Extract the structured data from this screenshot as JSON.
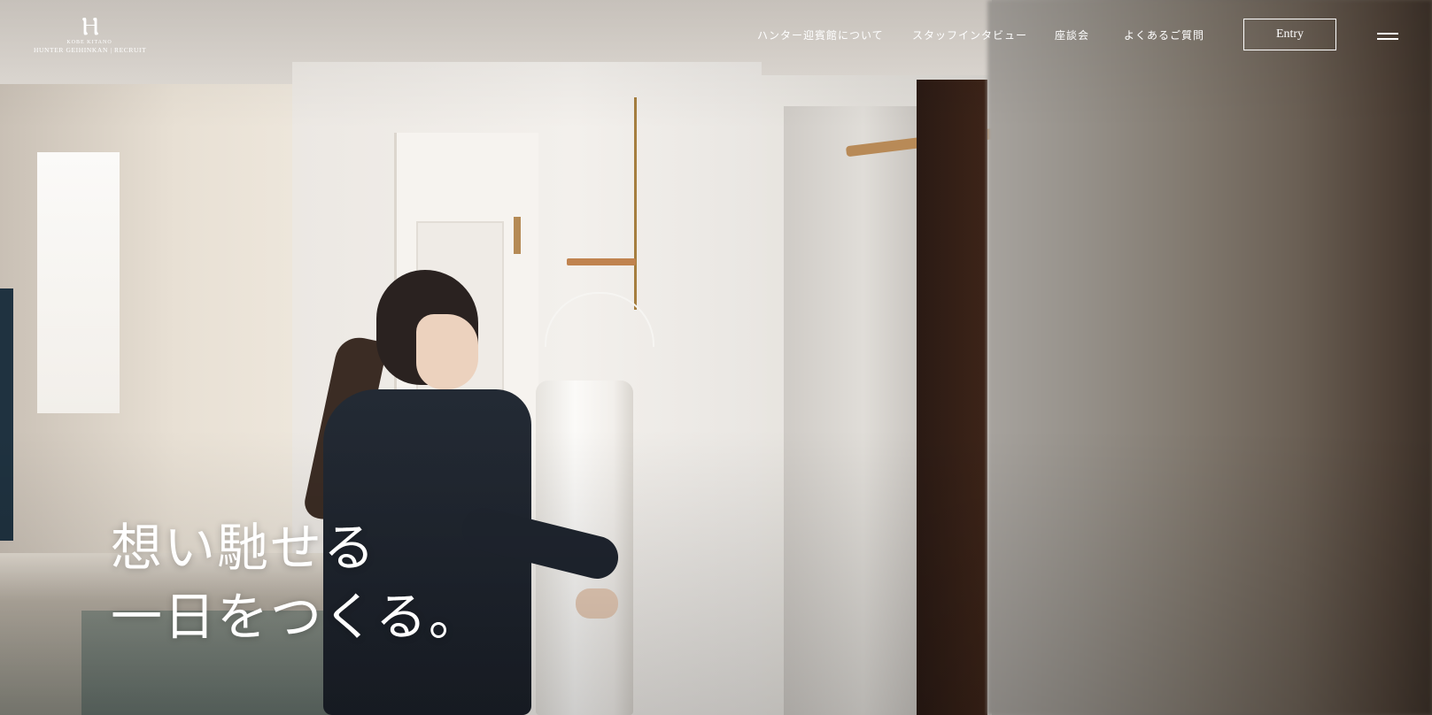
{
  "logo": {
    "mark": "Ⲏ",
    "small_text": "KOBE KITANO",
    "text": "HUNTER GEIHINKAN | RECRUIT"
  },
  "nav": {
    "items": [
      {
        "label": "ハンター迎賓館について"
      },
      {
        "label": "スタッフインタビュー"
      },
      {
        "label": "座談会"
      },
      {
        "label": "よくあるご質問"
      }
    ],
    "entry_label": "Entry",
    "menu_icon": "hamburger-menu-icon"
  },
  "hero": {
    "headline_line1": "想い馳せる",
    "headline_line2": "一日をつくる。"
  }
}
